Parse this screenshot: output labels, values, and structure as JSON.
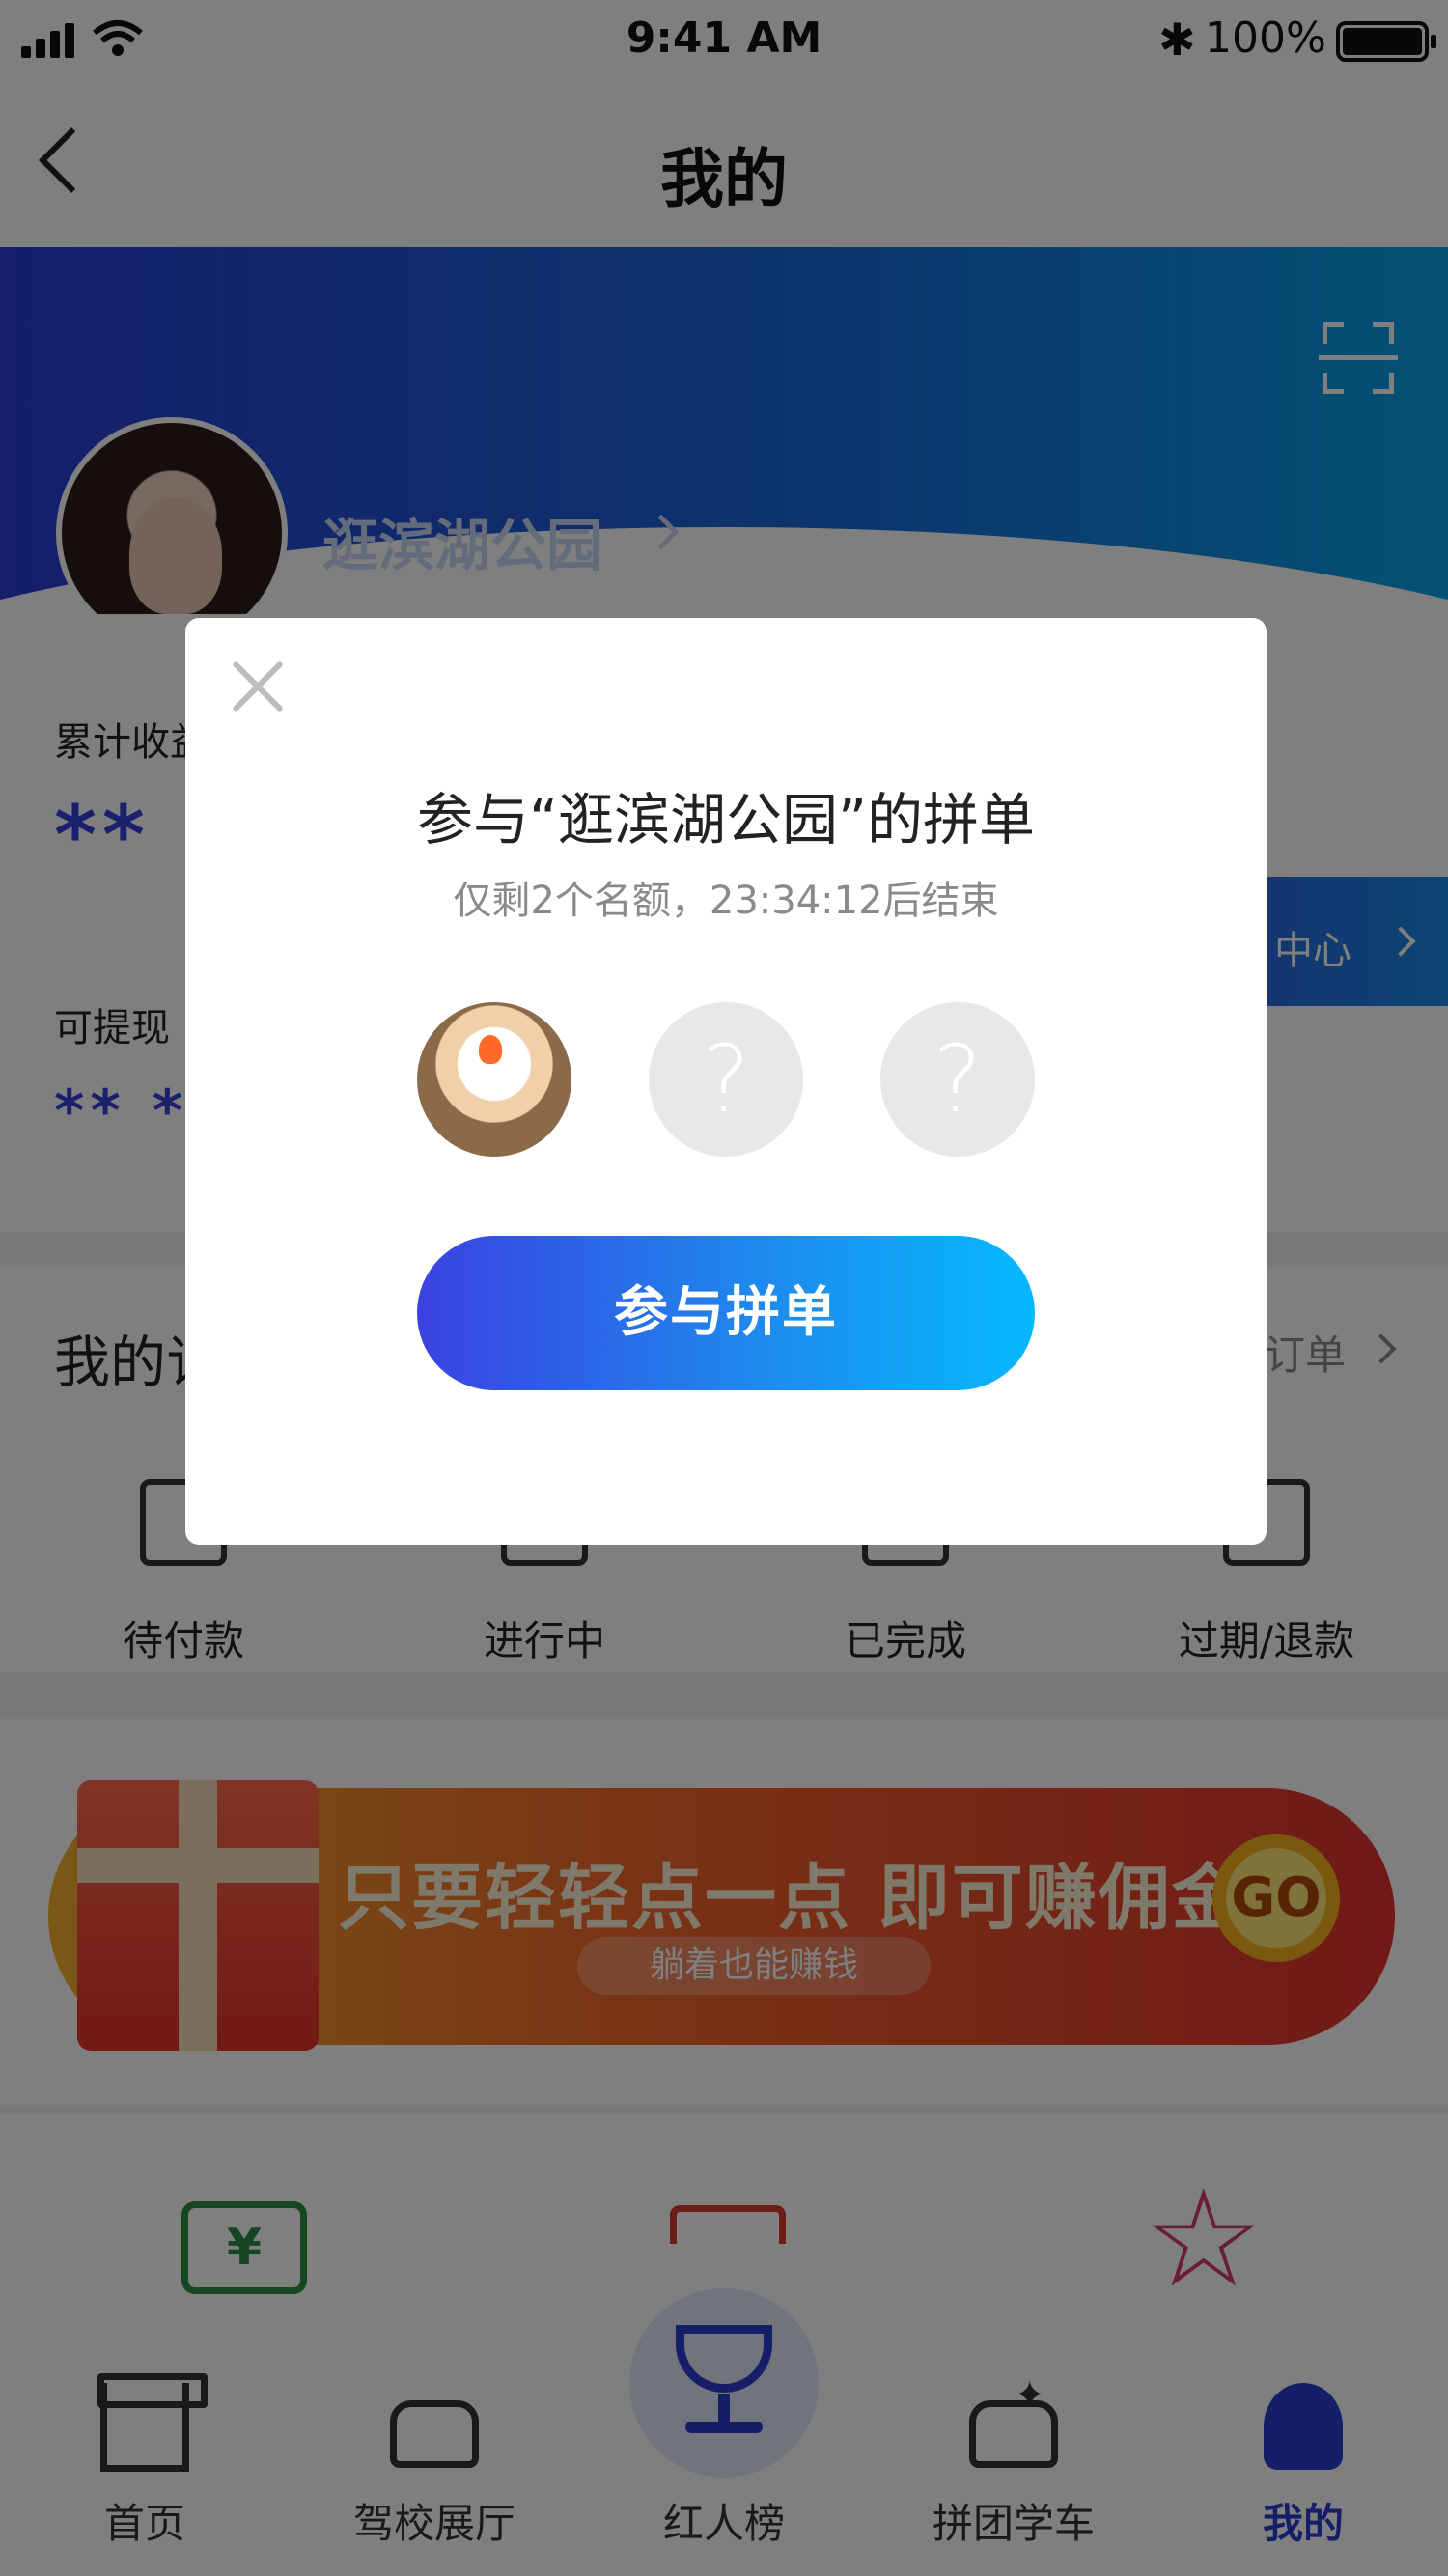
{
  "status_bar": {
    "time": "9:41 AM",
    "battery": "100%"
  },
  "nav": {
    "title": "我的"
  },
  "profile": {
    "name": "逛滨湖公园"
  },
  "earnings": {
    "total_label": "累计收益",
    "total_value": "**",
    "withdraw_label": "可提现",
    "withdraw_value": "** *",
    "center_link": "中心"
  },
  "orders": {
    "title": "我的订单",
    "all_link": "订单",
    "items": [
      {
        "label": "待付款"
      },
      {
        "label": "进行中"
      },
      {
        "label": "已完成"
      },
      {
        "label": "过期/退款"
      }
    ]
  },
  "promo": {
    "title": "只要轻轻点一点 即可赚佣金",
    "subtitle": "躺着也能赚钱",
    "go": "GO"
  },
  "tools": {
    "ticket_symbol": "¥",
    "star_symbol": "☆"
  },
  "tabbar": {
    "items": [
      {
        "label": "首页"
      },
      {
        "label": "驾校展厅"
      },
      {
        "label": "红人榜"
      },
      {
        "label": "拼团学车"
      },
      {
        "label": "我的"
      }
    ]
  },
  "modal": {
    "title": "参与“逛滨湖公园”的拼单",
    "subtitle": "仅剩2个名额，23:34:12后结束",
    "empty_slot": "?",
    "join_button": "参与拼单"
  },
  "colors": {
    "brand_blue": "#2b3fd0",
    "accent_cyan": "#06b8ff",
    "mask": "rgba(0,0,0,0.5)"
  }
}
